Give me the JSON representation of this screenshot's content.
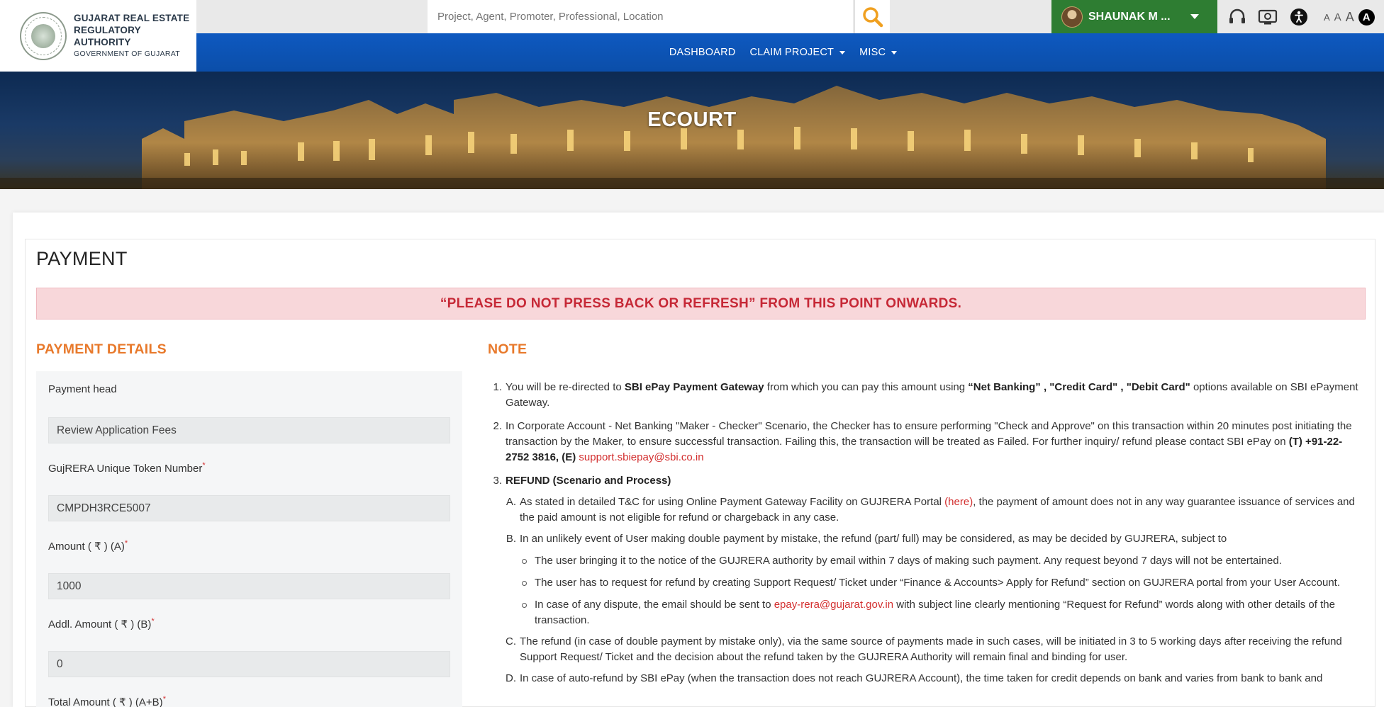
{
  "header": {
    "org_line1": "GUJARAT REAL ESTATE",
    "org_line2": "REGULATORY AUTHORITY",
    "org_line3": "GOVERNMENT OF GUJARAT",
    "search_placeholder": "Project, Agent, Promoter, Professional, Location",
    "user_name": "SHAUNAK M ...",
    "font_sizes": [
      "A",
      "A",
      "A",
      "A"
    ]
  },
  "nav": {
    "items": [
      "DASHBOARD",
      "CLAIM PROJECT",
      "MISC"
    ]
  },
  "banner": {
    "title": "ECOURT"
  },
  "page": {
    "title": "PAYMENT",
    "alert": "“PLEASE DO NOT PRESS BACK OR REFRESH” FROM THIS POINT ONWARDS."
  },
  "payment_details": {
    "heading": "PAYMENT DETAILS",
    "fields": [
      {
        "label": "Payment head",
        "required": false,
        "value": "Review Application Fees"
      },
      {
        "label": "GujRERA Unique Token Number",
        "required": true,
        "value": "CMPDH3RCE5007"
      },
      {
        "label": "Amount ( ₹ ) (A)",
        "required": true,
        "value": "1000"
      },
      {
        "label": "Addl. Amount ( ₹ ) (B)",
        "required": true,
        "value": "0"
      },
      {
        "label": "Total Amount ( ₹ ) (A+B)",
        "required": true,
        "value": ""
      }
    ]
  },
  "note": {
    "heading": "NOTE",
    "n1_a": "You will be re-directed to ",
    "n1_b": "SBI ePay Payment Gateway",
    "n1_c": " from which you can pay this amount using ",
    "n1_d": "“Net Banking” , \"Credit Card\" , \"Debit Card\"",
    "n1_e": " options available on SBI ePayment Gateway.",
    "n2_a": "In Corporate Account - Net Banking \"Maker - Checker\" Scenario, the Checker has to ensure performing \"Check and Approve\" on this transaction within 20 minutes post initiating the transaction by the Maker, to ensure successful transaction. Failing this, the transaction will be treated as Failed. For further inquiry/ refund please contact SBI ePay on ",
    "n2_b": "(T) +91-22-2752 3816, (E)",
    "n2_email": "support.sbiepay@sbi.co.in",
    "n3_title": "REFUND (Scenario and Process)",
    "n3a_a": "As stated in detailed T&C for using Online Payment Gateway Facility on GUJRERA Portal ",
    "n3a_link": "(here)",
    "n3a_b": ", the payment of amount does not in any way guarantee issuance of services and the paid amount is not eligible for refund or chargeback in any case.",
    "n3b": "In an unlikely event of User making double payment by mistake, the refund (part/ full) may be considered, as may be decided by GUJRERA, subject to",
    "b1": "The user bringing it to the notice of the GUJRERA authority by email within 7 days of making such payment. Any request beyond 7 days will not be entertained.",
    "b2": "The user has to request for refund by creating Support Request/ Ticket under “Finance & Accounts> Apply for Refund” section on GUJRERA portal from your User Account.",
    "b3_a": "In case of any dispute, the email should be sent to ",
    "b3_email": "epay-rera@gujarat.gov.in",
    "b3_b": " with subject line clearly mentioning “Request for Refund” words along with other details of the transaction.",
    "n3c": "The refund (in case of double payment by mistake only), via the same source of payments made in such cases, will be initiated in 3 to 5 working days after receiving the refund Support Request/ Ticket and the decision about the refund taken by the GUJRERA Authority will remain final and binding for user.",
    "n3d": "In case of auto-refund by SBI ePay (when the transaction does not reach GUJRERA Account), the time taken for credit depends on bank and varies from bank to bank and"
  },
  "colors": {
    "nav_blue": "#0b4ea9",
    "user_green": "#2e7d32",
    "accent_orange": "#e8792b",
    "alert_red": "#c62836",
    "alert_bg": "#f8d7da",
    "link_red": "#d32f2f"
  }
}
